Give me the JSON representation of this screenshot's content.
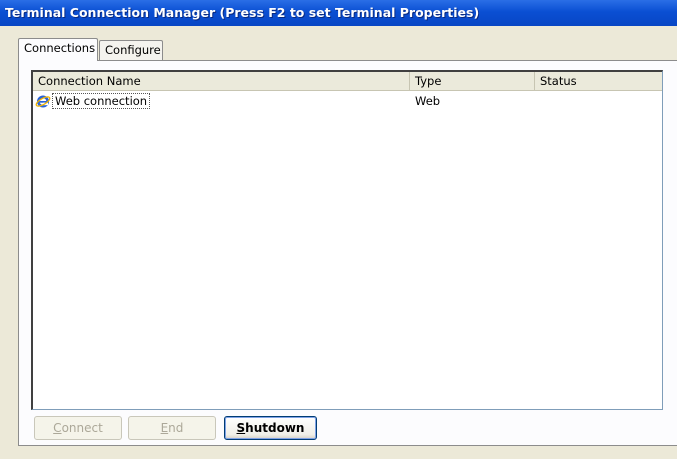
{
  "window": {
    "title": "Terminal Connection Manager (Press F2 to set Terminal Properties)"
  },
  "tabs": [
    {
      "label": "Connections",
      "active": true
    },
    {
      "label": "Configure",
      "active": false
    }
  ],
  "list": {
    "columns": [
      "Connection Name",
      "Type",
      "Status"
    ],
    "rows": [
      {
        "name": "Web connection",
        "type": "Web",
        "status": "",
        "icon": "internet-explorer-icon"
      }
    ]
  },
  "buttons": {
    "connect": {
      "accel": "C",
      "rest": "onnect",
      "enabled": false
    },
    "end": {
      "accel": "E",
      "rest": "nd",
      "enabled": false
    },
    "shutdown": {
      "accel": "S",
      "rest": "hutdown",
      "enabled": true
    }
  },
  "colors": {
    "titlebar": "#0a4fd3",
    "window_bg": "#ece9d8",
    "disabled_text": "#aca899"
  }
}
